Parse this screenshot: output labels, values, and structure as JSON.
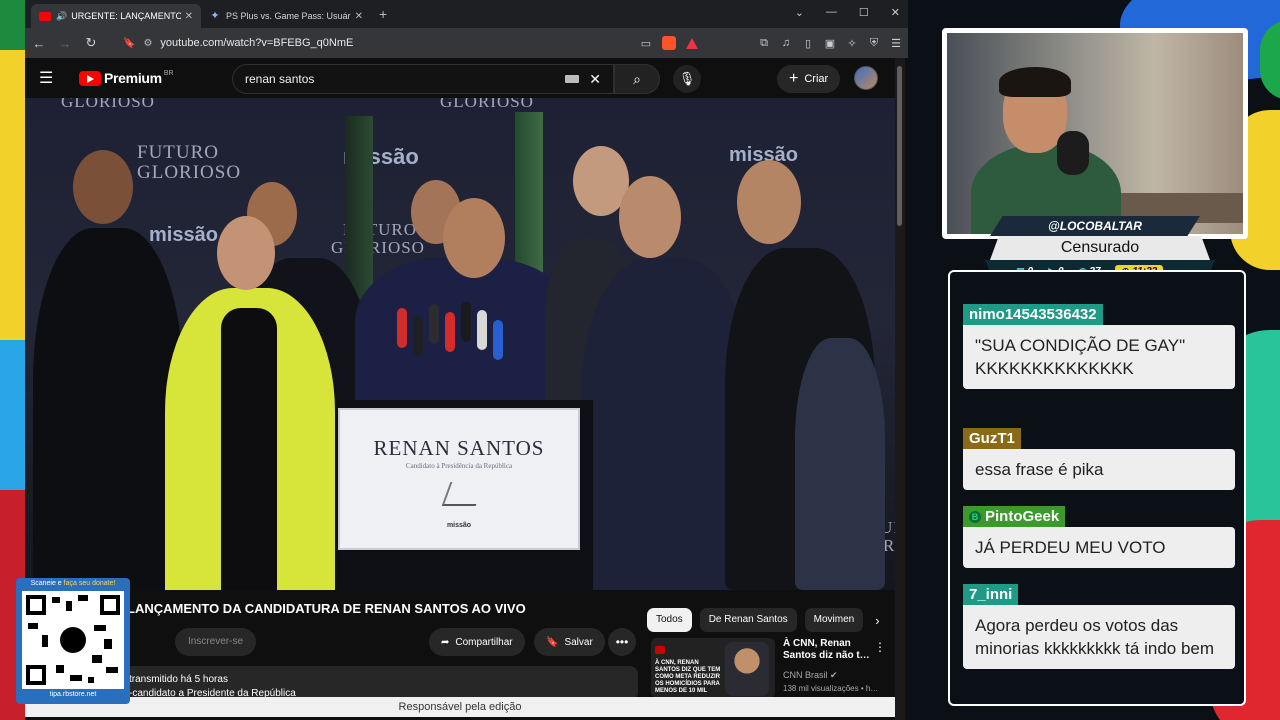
{
  "browser": {
    "tabs": [
      {
        "label": "URGENTE: LANÇAMENTO DA CANDI",
        "active": true
      },
      {
        "label": "PS Plus vs. Game Pass: Usuários Ativos - Gem",
        "active": false
      }
    ],
    "url": "youtube.com/watch?v=BFEBG_q0NmE"
  },
  "youtube": {
    "logo_text": "Premium",
    "region": "BR",
    "search_value": "renan santos",
    "create_label": "Criar",
    "video": {
      "backdrop": {
        "slogan_line1": "FUTURO",
        "slogan_line2": "GLORIOSO",
        "top_left": "GLORIOSO",
        "top_mid": "GLORIOSO",
        "brand": "missão"
      },
      "podium": {
        "name": "RENAN SANTOS",
        "subtitle": "Candidato à Presidência da República",
        "logo": "missão"
      }
    },
    "title": "LANÇAMENTO DA CANDIDATURA DE RENAN SANTOS AO VIVO",
    "subscribe_label": "Inscrever-se",
    "share_label": "Compartilhar",
    "save_label": "Salvar",
    "desc_line1": "transmitido há 5 horas",
    "desc_line2": "-candidato a Presidente da República",
    "chips": [
      "Todos",
      "De Renan Santos",
      "Movimen"
    ],
    "rec": {
      "title": "À CNN, Renan Santos diz não t…",
      "channel": "CNN Brasil",
      "views": "138 mil visualizações • h…",
      "thumb_text": "À CNN, RENAN SANTOS DIZ QUE TEM COMO META REDUZIR OS HOMICÍDIOS PARA MENOS DE 10 MIL"
    },
    "caption": "Responsável pela edição"
  },
  "qr": {
    "head_a": "Scaneie e",
    "head_b": "faça seu donate!",
    "foot": "tipa.rbstore.net"
  },
  "stream": {
    "handle": "@LOCOBALTAR",
    "status": "Censurado",
    "stats": [
      {
        "icon": "monitor-icon",
        "value": "0"
      },
      {
        "icon": "youtube-icon",
        "value": "0"
      },
      {
        "icon": "viewers-icon",
        "value": "27"
      }
    ],
    "time": "11:22"
  },
  "chat": [
    {
      "user": "nimo14543536432",
      "color": "#1f9a86",
      "text": "\"SUA CONDIÇÃO DE GAY\" KKKKKKKKKKKKKK",
      "badge": false
    },
    {
      "user": "GuzT1",
      "color": "#8a6a16",
      "text": "essa frase é pika",
      "badge": false
    },
    {
      "user": "PintoGeek",
      "color": "#3a9a2a",
      "text": "JÁ PERDEU MEU VOTO",
      "badge": true
    },
    {
      "user": "7_inni",
      "color": "#1f9a86",
      "text": "Agora perdeu os votos das minorias kkkkkkkkk tá indo bem",
      "badge": false
    }
  ],
  "colors": {
    "accent_red": "#ff0000",
    "chat_teal": "#1f9a86",
    "timer_yellow": "#f2d12a"
  }
}
